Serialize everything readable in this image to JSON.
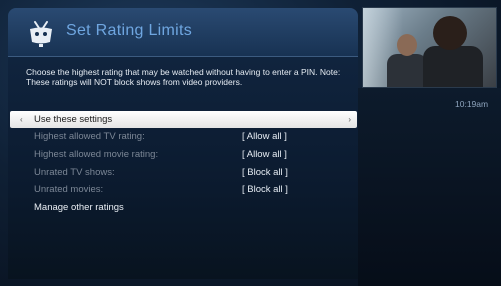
{
  "header": {
    "title": "Set Rating Limits",
    "logo_icon": "tivo-logo-icon"
  },
  "instructions": "Choose the highest rating that may be watched without having to enter a PIN. Note: These ratings will NOT block shows from video providers.",
  "menu": {
    "selected": {
      "label": "Use these settings",
      "left_arrow": "‹",
      "right_arrow": "›"
    },
    "rows": [
      {
        "label": "Highest allowed TV rating:",
        "value": "[ Allow all ]"
      },
      {
        "label": "Highest allowed movie rating:",
        "value": "[ Allow all ]"
      },
      {
        "label": "Unrated TV shows:",
        "value": "[ Block all ]"
      },
      {
        "label": "Unrated movies:",
        "value": "[ Block all ]"
      }
    ],
    "manage": "Manage other ratings"
  },
  "clock": "10:19am",
  "colors": {
    "title": "#6fa6e0",
    "background": "#0f2035",
    "selected_row": "#ffffff",
    "dim_text": "#7c8796"
  }
}
